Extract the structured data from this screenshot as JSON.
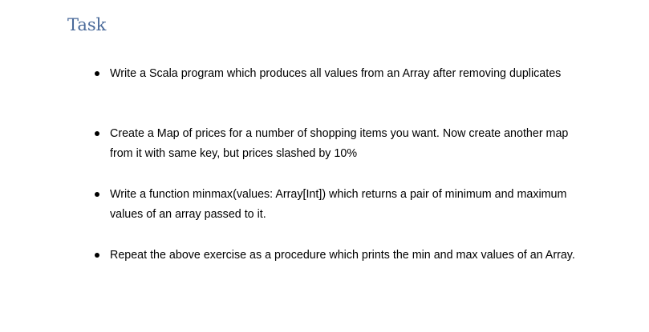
{
  "title": "Task",
  "items": [
    {
      "text": "Write a Scala program which produces all values from an Array after removing duplicates"
    },
    {
      "text": "Create a Map of prices for a number of shopping items you want. Now create another map from it with same key, but prices slashed by 10%"
    },
    {
      "text": "Write a function minmax(values: Array[Int]) which returns a pair of minimum and maximum values of an array passed to it."
    },
    {
      "text": "Repeat the above exercise as a procedure which prints the min and max values of an Array."
    }
  ]
}
